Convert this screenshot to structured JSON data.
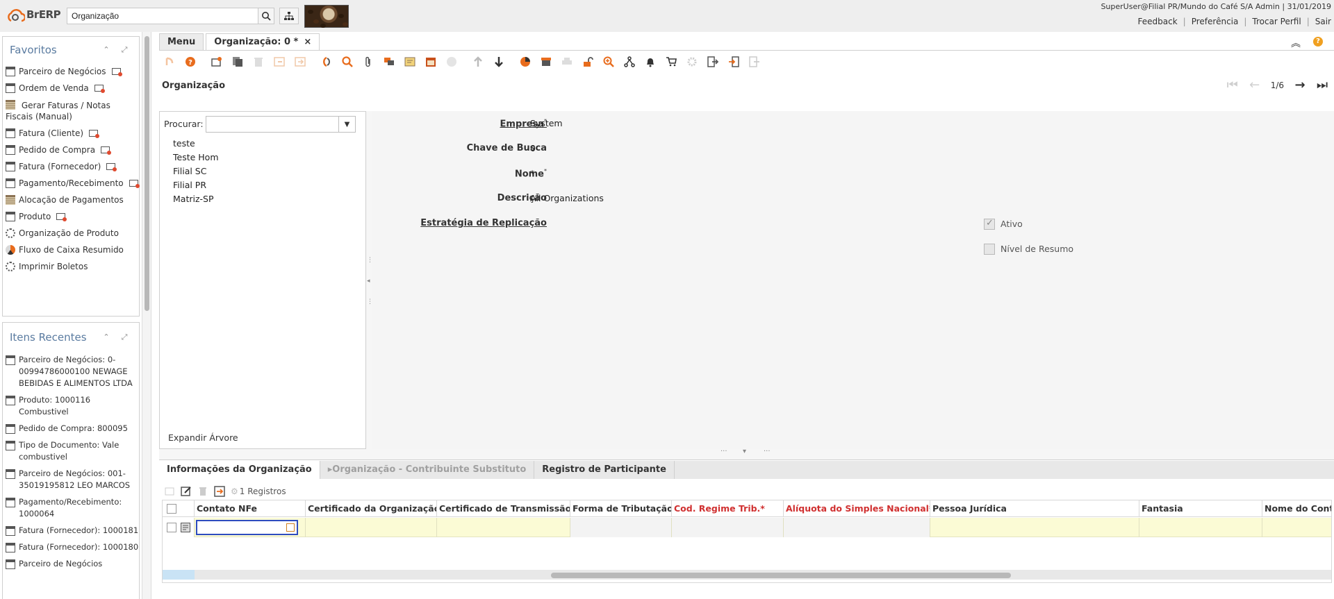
{
  "header": {
    "logo_text": "BrERP",
    "search_value": "Organização",
    "user_info": "SuperUser@Filial PR/Mundo do Café S/A Admin | 31/01/2019",
    "links": [
      "Feedback",
      "Preferência",
      "Trocar Perfil",
      "Sair"
    ]
  },
  "favorites": {
    "title": "Favoritos",
    "items": [
      {
        "label": "Parceiro de Negócios",
        "icon": "window-icon"
      },
      {
        "label": "Ordem de Venda",
        "icon": "window-icon"
      },
      {
        "label": "Gerar Faturas / Notas Fiscais (Manual)",
        "icon": "report-icon"
      },
      {
        "label": "Fatura (Cliente)",
        "icon": "window-icon"
      },
      {
        "label": "Pedido de Compra",
        "icon": "window-icon"
      },
      {
        "label": "Fatura (Fornecedor)",
        "icon": "window-icon"
      },
      {
        "label": "Pagamento/Recebimento",
        "icon": "window-icon"
      },
      {
        "label": "Alocação de Pagamentos",
        "icon": "report-icon"
      },
      {
        "label": "Produto",
        "icon": "window-icon"
      },
      {
        "label": "Organização de Produto",
        "icon": "gear-icon"
      },
      {
        "label": "Fluxo de Caixa Resumido",
        "icon": "pie-icon"
      },
      {
        "label": "Imprimir Boletos",
        "icon": "gear-icon"
      }
    ]
  },
  "recent": {
    "title": "Itens Recentes",
    "items": [
      "Parceiro de Negócios: 0-00994786000100 NEWAGE BEBIDAS E ALIMENTOS LTDA",
      "Produto: 1000116 Combustivel",
      "Pedido de Compra: 800095",
      "Tipo de Documento: Vale combustivel",
      "Parceiro de Negócios: 001-35019195812 LEO MARCOS",
      "Pagamento/Recebimento: 1000064",
      "Fatura (Fornecedor): 1000181",
      "Fatura (Fornecedor): 1000180",
      "Parceiro de Negócios"
    ]
  },
  "tabs": {
    "menu": "Menu",
    "active": "Organização: 0 *",
    "close": "×"
  },
  "window": {
    "title": "Organização",
    "record_position": "1/6"
  },
  "tree": {
    "search_label": "Procurar:",
    "items": [
      "teste",
      "Teste Hom",
      "Filial SC",
      "Filial PR",
      "Matriz-SP"
    ],
    "expand_label": "Expandir Árvore"
  },
  "form": {
    "empresa_label": "Empresa",
    "empresa_value": "System",
    "chave_label": "Chave de Busca",
    "chave_value": "0",
    "nome_label": "Nome",
    "nome_value": "*",
    "descricao_label": "Descrição",
    "descricao_value": "All Organizations",
    "estrategia_label": "Estratégia de Replicação",
    "ativo_label": "Ativo",
    "ativo_checked": true,
    "resumo_label": "Nível de Resumo",
    "resumo_checked": false
  },
  "detail": {
    "tabs": [
      "Informações da Organização",
      "Organização - Contribuinte Substituto",
      "Registro de Participante"
    ],
    "records": "1 Registros",
    "columns": [
      {
        "label": "Contato NFe",
        "required": false
      },
      {
        "label": "Certificado da Organização",
        "required": false
      },
      {
        "label": "Certificado de Transmissão",
        "required": false
      },
      {
        "label": "Forma de Tributação",
        "required": false
      },
      {
        "label": "Cod. Regime Trib.*",
        "required": true
      },
      {
        "label": "Alíquota do Simples Nacional*",
        "required": true
      },
      {
        "label": "Pessoa Jurídica",
        "required": false
      },
      {
        "label": "Fantasia",
        "required": false
      },
      {
        "label": "Nome do Conta",
        "required": false
      }
    ]
  },
  "colors": {
    "accent": "#e86c1d",
    "header_bg": "#eeeeee",
    "required_red": "#d03030",
    "row_yellow": "#fbfbd5",
    "title_blue": "#5a7ba0"
  }
}
